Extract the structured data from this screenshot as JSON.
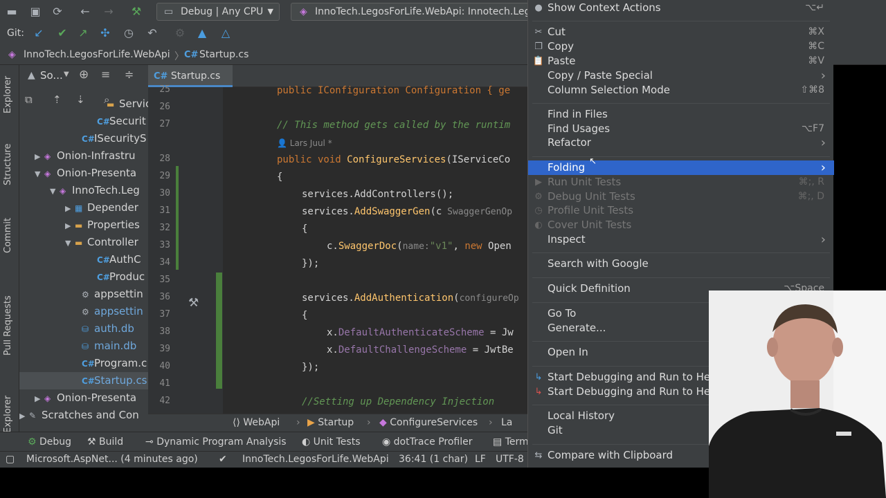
{
  "toolbar": {
    "config": "Debug | Any CPU",
    "run_target": "InnoTech.LegosForLife.WebApi: Innotech.Lego"
  },
  "git": {
    "label": "Git:"
  },
  "nav": {
    "project": "InnoTech.LegosForLife.WebApi",
    "file": "Startup.cs",
    "cs": "C#"
  },
  "left_strip": {
    "tabs": [
      "Explorer",
      "Structure",
      "Commit",
      "Pull Requests",
      "Explorer"
    ]
  },
  "project_panel": {
    "title": "So...",
    "rows": [
      {
        "label": "Services",
        "icon": "folder",
        "arrow": ""
      },
      {
        "label": "Securit",
        "icon": "C#",
        "arrow": ""
      },
      {
        "label": "ISecurityS",
        "icon": "C#",
        "arrow": ""
      },
      {
        "label": "Onion-Infrastru",
        "icon": "project",
        "arrow": "▶"
      },
      {
        "label": "Onion-Presenta",
        "icon": "project",
        "arrow": "▼"
      },
      {
        "label": "InnoTech.Leg",
        "icon": "project",
        "arrow": "▼"
      },
      {
        "label": "Depender",
        "icon": "dep",
        "arrow": "▶"
      },
      {
        "label": "Properties",
        "icon": "folder",
        "arrow": "▶"
      },
      {
        "label": "Controller",
        "icon": "folder",
        "arrow": "▼"
      },
      {
        "label": "AuthC",
        "icon": "C#",
        "arrow": ""
      },
      {
        "label": "Produc",
        "icon": "C#",
        "arrow": ""
      },
      {
        "label": "appsettin",
        "icon": "cfg",
        "arrow": ""
      },
      {
        "label": "appsettin",
        "icon": "cfg",
        "arrow": ""
      },
      {
        "label": "auth.db",
        "icon": "db",
        "arrow": ""
      },
      {
        "label": "main.db",
        "icon": "db",
        "arrow": ""
      },
      {
        "label": "Program.c",
        "icon": "C#",
        "arrow": ""
      },
      {
        "label": "Startup.cs",
        "icon": "C#",
        "arrow": ""
      },
      {
        "label": "Onion-Presenta",
        "icon": "project",
        "arrow": "▶"
      },
      {
        "label": "Scratches and Con",
        "icon": "scratch",
        "arrow": "▶"
      }
    ]
  },
  "editor": {
    "tab": "Startup.cs",
    "author": "Lars Juul *",
    "line_numbers": [
      "25",
      "26",
      "27",
      "",
      "28",
      "29",
      "30",
      "31",
      "32",
      "33",
      "34",
      "35",
      "36",
      "37",
      "38",
      "39",
      "40",
      "41",
      "42"
    ],
    "lines": {
      "l25": "public IConfiguration Configuration { ge",
      "l27": "// This method gets called by the runtim",
      "l28a": "public void ",
      "l28b": "ConfigureServices",
      "l28c": "(IServiceCo",
      "l29": "{",
      "l30": "services.AddControllers();",
      "l31a": "services.",
      "l31b": "AddSwaggerGen",
      "l31c": "(c",
      "l31h": " SwaggerGenOp",
      "l32": "{",
      "l33a": "c.",
      "l33b": "SwaggerDoc",
      "l33c": "(",
      "l33h": "name:",
      "l33s": "\"v1\"",
      "l33d": ", ",
      "l33k": "new",
      "l33e": " Open",
      "l34": "});",
      "l36a": "services.",
      "l36b": "AddAuthentication",
      "l36c": "(",
      "l36h": "configureOp",
      "l37": "{",
      "l38a": "x.",
      "l38b": "DefaultAuthenticateScheme",
      "l38c": " = Jw",
      "l39a": "x.",
      "l39b": "DefaultChallengeScheme",
      "l39c": " = JwtBe",
      "l40": "});",
      "l42": "//Setting up Dependency Injection"
    },
    "breadcrumb": [
      "WebApi",
      "Startup",
      "ConfigureServices",
      "La"
    ]
  },
  "toolwindows": [
    "Debug",
    "Build",
    "Dynamic Program Analysis",
    "Unit Tests",
    "dotTrace Profiler",
    "Term"
  ],
  "status": {
    "vcs": "Microsoft.AspNet... (4 minutes ago)",
    "project": "InnoTech.LegosForLife.WebApi",
    "position": "36:41 (1 char)",
    "eol": "LF",
    "encoding": "UTF-8"
  },
  "menu": {
    "items": [
      {
        "label": "Show Context Actions",
        "shortcut": "⌥↵",
        "icon": "bulb",
        "state": "normal"
      },
      {
        "label": "Cut",
        "shortcut": "⌘X",
        "icon": "cut",
        "state": "normal"
      },
      {
        "label": "Copy",
        "shortcut": "⌘C",
        "icon": "copy",
        "state": "normal"
      },
      {
        "label": "Paste",
        "shortcut": "⌘V",
        "icon": "paste",
        "state": "normal"
      },
      {
        "label": "Copy / Paste Special",
        "shortcut": "",
        "icon": "",
        "state": "submenu"
      },
      {
        "label": "Column Selection Mode",
        "shortcut": "⇧⌘8",
        "icon": "",
        "state": "normal"
      },
      {
        "label": "Find in Files",
        "shortcut": "",
        "icon": "",
        "state": "normal"
      },
      {
        "label": "Find Usages",
        "shortcut": "⌥F7",
        "icon": "",
        "state": "normal"
      },
      {
        "label": "Refactor",
        "shortcut": "",
        "icon": "",
        "state": "submenu"
      },
      {
        "label": "Folding",
        "shortcut": "",
        "icon": "",
        "state": "highlight"
      },
      {
        "label": "Run Unit Tests",
        "shortcut": "⌘;, R",
        "icon": "run",
        "state": "disabled"
      },
      {
        "label": "Debug Unit Tests",
        "shortcut": "⌘;, D",
        "icon": "debug",
        "state": "disabled"
      },
      {
        "label": "Profile Unit Tests",
        "shortcut": "",
        "icon": "profile",
        "state": "disabled"
      },
      {
        "label": "Cover Unit Tests",
        "shortcut": "",
        "icon": "cover",
        "state": "disabled"
      },
      {
        "label": "Inspect",
        "shortcut": "",
        "icon": "",
        "state": "submenu"
      },
      {
        "label": "Search with Google",
        "shortcut": "",
        "icon": "",
        "state": "normal"
      },
      {
        "label": "Quick Definition",
        "shortcut": "⌥Space",
        "icon": "",
        "state": "normal"
      },
      {
        "label": "Go To",
        "shortcut": "",
        "icon": "",
        "state": "submenu"
      },
      {
        "label": "Generate...",
        "shortcut": "",
        "icon": "",
        "state": "normal"
      },
      {
        "label": "Open In",
        "shortcut": "",
        "icon": "",
        "state": "normal"
      },
      {
        "label": "Start Debugging and Run to Here",
        "shortcut": "",
        "icon": "dbgrun",
        "state": "normal"
      },
      {
        "label": "Start Debugging and Run to Here Non-St",
        "shortcut": "",
        "icon": "dbgrun2",
        "state": "normal"
      },
      {
        "label": "Local History",
        "shortcut": "",
        "icon": "",
        "state": "normal"
      },
      {
        "label": "Git",
        "shortcut": "",
        "icon": "",
        "state": "normal"
      },
      {
        "label": "Compare with Clipboard",
        "shortcut": "",
        "icon": "compare",
        "state": "normal"
      }
    ]
  },
  "colors": {
    "accent": "#2f65ca",
    "panel": "#3c3f41",
    "editor": "#2b2b2b"
  }
}
